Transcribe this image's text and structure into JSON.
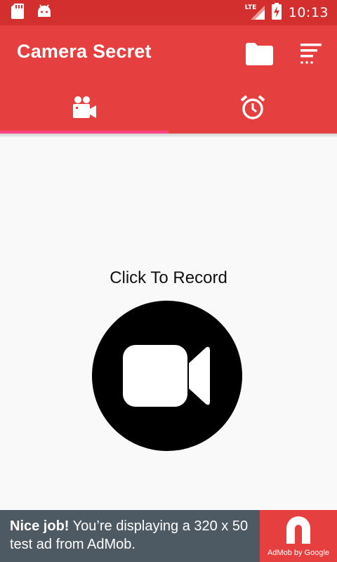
{
  "status_bar": {
    "network": "LTE",
    "time": "10:13"
  },
  "app_bar": {
    "title": "Camera Secret"
  },
  "tabs": [
    {
      "icon": "video-camera-icon",
      "selected": true
    },
    {
      "icon": "alarm-clock-icon",
      "selected": false
    }
  ],
  "main": {
    "record_label": "Click To Record"
  },
  "ad": {
    "headline": "Nice job!",
    "body": "You’re displaying a 320 x 50 test ad from AdMob.",
    "brand": "AdMob by Google"
  },
  "colors": {
    "primary": "#e53f3f",
    "primary_dark": "#d32f2f",
    "accent": "#ff4081",
    "ad_background": "#4d5a63"
  }
}
